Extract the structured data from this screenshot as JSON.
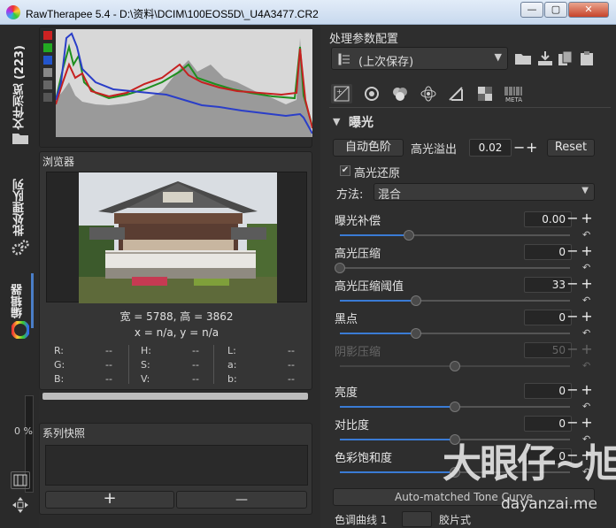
{
  "window": {
    "title": "RawTherapee 5.4 - D:\\资料\\DCIM\\100EOS5D\\_U4A3477.CR2",
    "minimize": "—",
    "maximize": "▢",
    "close": "✕"
  },
  "left_tabs": {
    "file_browser": "文件浏览 (223)",
    "queue": "批处理队列",
    "editor": "编辑器",
    "progress": "0 %"
  },
  "navigator": {
    "title": "浏览器",
    "size_text": "宽 = 5788, 高 = 3862",
    "coords_text": "x = n/a, y = n/a",
    "info": [
      {
        "k": "R:",
        "v": "--"
      },
      {
        "k": "H:",
        "v": "--"
      },
      {
        "k": "L:",
        "v": "--"
      },
      {
        "k": "G:",
        "v": "--"
      },
      {
        "k": "S:",
        "v": "--"
      },
      {
        "k": "a:",
        "v": "--"
      },
      {
        "k": "B:",
        "v": "--"
      },
      {
        "k": "V:",
        "v": "--"
      },
      {
        "k": "b:",
        "v": "--"
      }
    ]
  },
  "snapshots": {
    "title": "系列快照",
    "add": "+",
    "remove": "—"
  },
  "profile": {
    "title": "处理参数配置",
    "selected": "(上次保存)"
  },
  "exposure": {
    "section_title": "曝光",
    "auto_levels": "自动色阶",
    "highlight_clip_label": "高光溢出",
    "highlight_clip_value": "0.02",
    "reset": "Reset",
    "highlight_recovery_label": "高光还原",
    "method_label": "方法:",
    "method_value": "混合",
    "sliders": [
      {
        "name": "曝光补偿",
        "value": "0.00",
        "level": 0.3
      },
      {
        "name": "高光压缩",
        "value": "0",
        "level": 0.0
      },
      {
        "name": "高光压缩阈值",
        "value": "33",
        "level": 0.33
      },
      {
        "name": "黑点",
        "value": "0",
        "level": 0.33
      },
      {
        "name": "阴影压缩",
        "value": "50",
        "level": 0.5
      },
      {
        "name": "亮度",
        "value": "0",
        "level": 0.5
      },
      {
        "name": "对比度",
        "value": "0",
        "level": 0.5
      },
      {
        "name": "色彩饱和度",
        "value": "0",
        "level": 0.5
      }
    ],
    "tone_curve_button": "Auto-matched Tone Curve",
    "tone_curve_row": "色调曲线 1",
    "tone_curve_mode": "胶片式"
  },
  "watermark": {
    "big": "大眼仔~旭",
    "small": "dayanzai.me"
  },
  "colors": {
    "accent": "#3a7bd5",
    "panel": "#353535",
    "background": "#2b2b2b"
  }
}
